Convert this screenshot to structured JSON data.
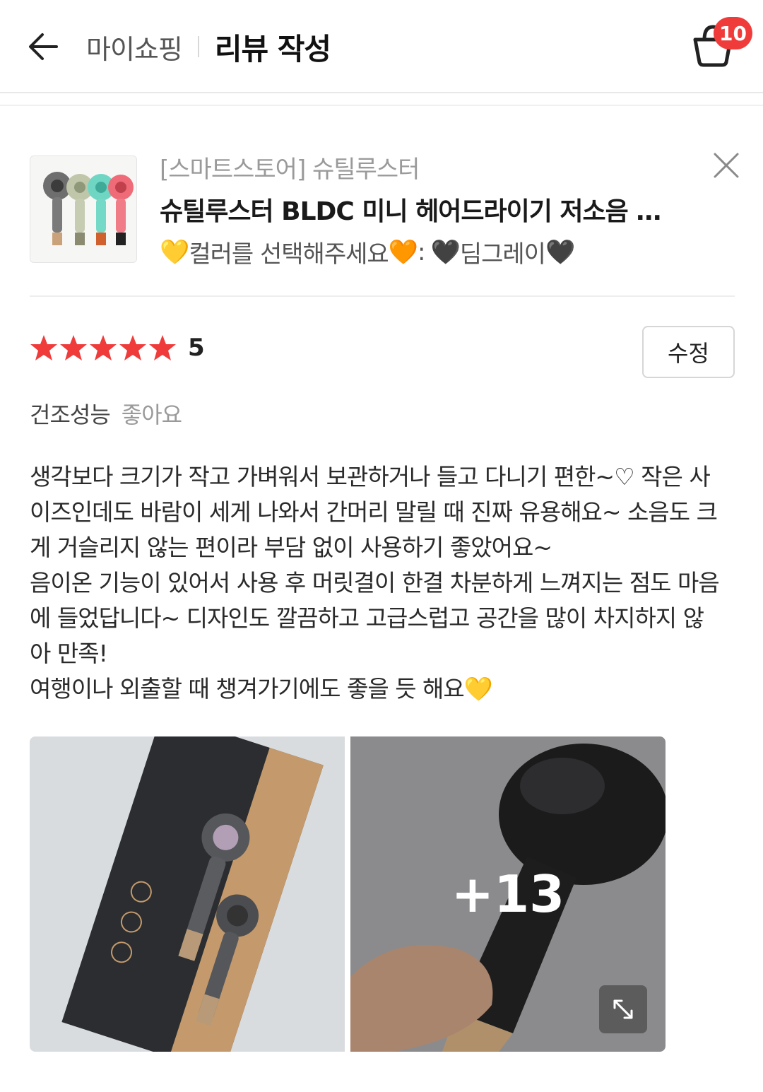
{
  "header": {
    "crumb": "마이쇼핑",
    "title": "리뷰 작성",
    "cart_count": "10"
  },
  "product": {
    "store": "[스마트스토어] 슈틸루스터",
    "name": "슈틸루스터 BLDC 미니 헤어드라이기 저소음 무선 음이온 드라이어",
    "option_emoji_left": "💛",
    "option_label": "컬러를 선택해주세요",
    "option_emoji_right": "🧡",
    "option_sep": ":",
    "option_emoji_black": "🖤",
    "option_value": "딤그레이"
  },
  "rating": {
    "stars": 5,
    "value": "5",
    "edit_label": "수정"
  },
  "attribute": {
    "label": "건조성능",
    "value": "좋아요"
  },
  "review_lines": [
    "생각보다 크기가 작고 가벼워서 보관하거나 들고 다니기 편한~♡ 작은 사",
    "이즈인데도 바람이 세게 나와서 간머리 말릴 때 진짜 유용해요~ 소음도 크",
    "게 거슬리지 않는 편이라 부담 없이 사용하기 좋았어요~",
    "음이온 기능이 있어서 사용 후 머릿결이 한결 차분하게 느껴지는 점도 마음",
    "에 들었답니다~  디자인도 깔끔하고 고급스럽고 공간을 많이 차지하지 않",
    "아 만족!",
    "여행이나 외출할 때 챙겨가기에도 좋을 듯 해요💛"
  ],
  "photos": {
    "more_count": "+13"
  },
  "colors": {
    "star": "#f03b3b",
    "badge": "#f03b3b"
  },
  "icons": [
    "back-arrow-icon",
    "cart-icon",
    "close-icon",
    "star-icon",
    "expand-icon"
  ]
}
